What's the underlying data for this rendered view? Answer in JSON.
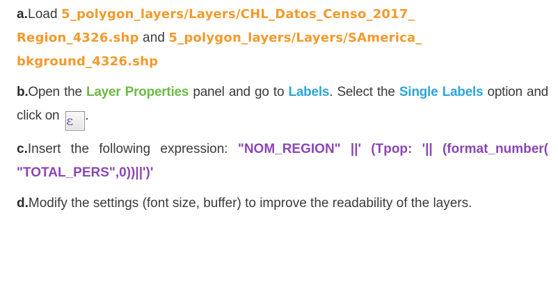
{
  "steps": [
    {
      "marker": "a.",
      "t1": "Load ",
      "path1a": "5_polygon_layers/Layers/CHL_Datos_Censo_2017_",
      "path1b": "Region_4326.shp",
      "t2": " and ",
      "path2a": "5_polygon_layers/Layers/SAmerica_",
      "path2b": "bkground_4326.shp"
    },
    {
      "marker": "b.",
      "t1": "Open the ",
      "h1": "Layer Properties",
      "t2": " panel and go to ",
      "h2": "Labels",
      "t3": ". Select the ",
      "h3": "Single Labels",
      "t4": " option and click on ",
      "button_glyph": "ε",
      "t5": "."
    },
    {
      "marker": "c.",
      "t1": "Insert the following expression: ",
      "expr": "\"NOM_REGION\" ||' (Tpop: '|| (format_number( \"TOTAL_PERS\",0))||')'"
    },
    {
      "marker": "d.",
      "t1": "Modify the settings (font size, buffer) to improve the readability of the layers."
    }
  ],
  "colors": {
    "path": "#f39a2c",
    "layer_properties": "#6cba45",
    "labels": "#2aa6d9",
    "expression": "#8b46b4"
  }
}
